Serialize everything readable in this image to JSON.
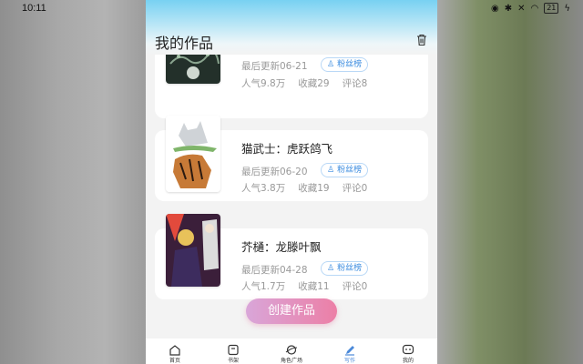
{
  "status": {
    "time": "10:11",
    "battery": "21"
  },
  "header": {
    "title": "我的作品"
  },
  "works": [
    {
      "title": "",
      "updated": "最后更新06-21",
      "badge": "粉丝榜",
      "popularity": "人气9.8万",
      "favorites": "收藏29",
      "comments": "评论8"
    },
    {
      "title": "猫武士：虎跃鸽飞",
      "updated": "最后更新06-20",
      "badge": "粉丝榜",
      "popularity": "人气3.8万",
      "favorites": "收藏19",
      "comments": "评论0"
    },
    {
      "title": "芥樋：龙滕叶飘",
      "updated": "最后更新04-28",
      "badge": "粉丝榜",
      "popularity": "人气1.7万",
      "favorites": "收藏11",
      "comments": "评论0"
    }
  ],
  "create_button": "创建作品",
  "tabs": [
    {
      "label": "首页",
      "icon": "home-icon"
    },
    {
      "label": "书架",
      "icon": "bookshelf-icon"
    },
    {
      "label": "角色广场",
      "icon": "planet-icon"
    },
    {
      "label": "写作",
      "icon": "pen-icon",
      "active": true
    },
    {
      "label": "我的",
      "icon": "profile-icon"
    }
  ],
  "colors": {
    "accent": "#4b89d9",
    "create_start": "#d9a6d9",
    "create_end": "#ec7fa6",
    "sky": "#78d1f2"
  }
}
